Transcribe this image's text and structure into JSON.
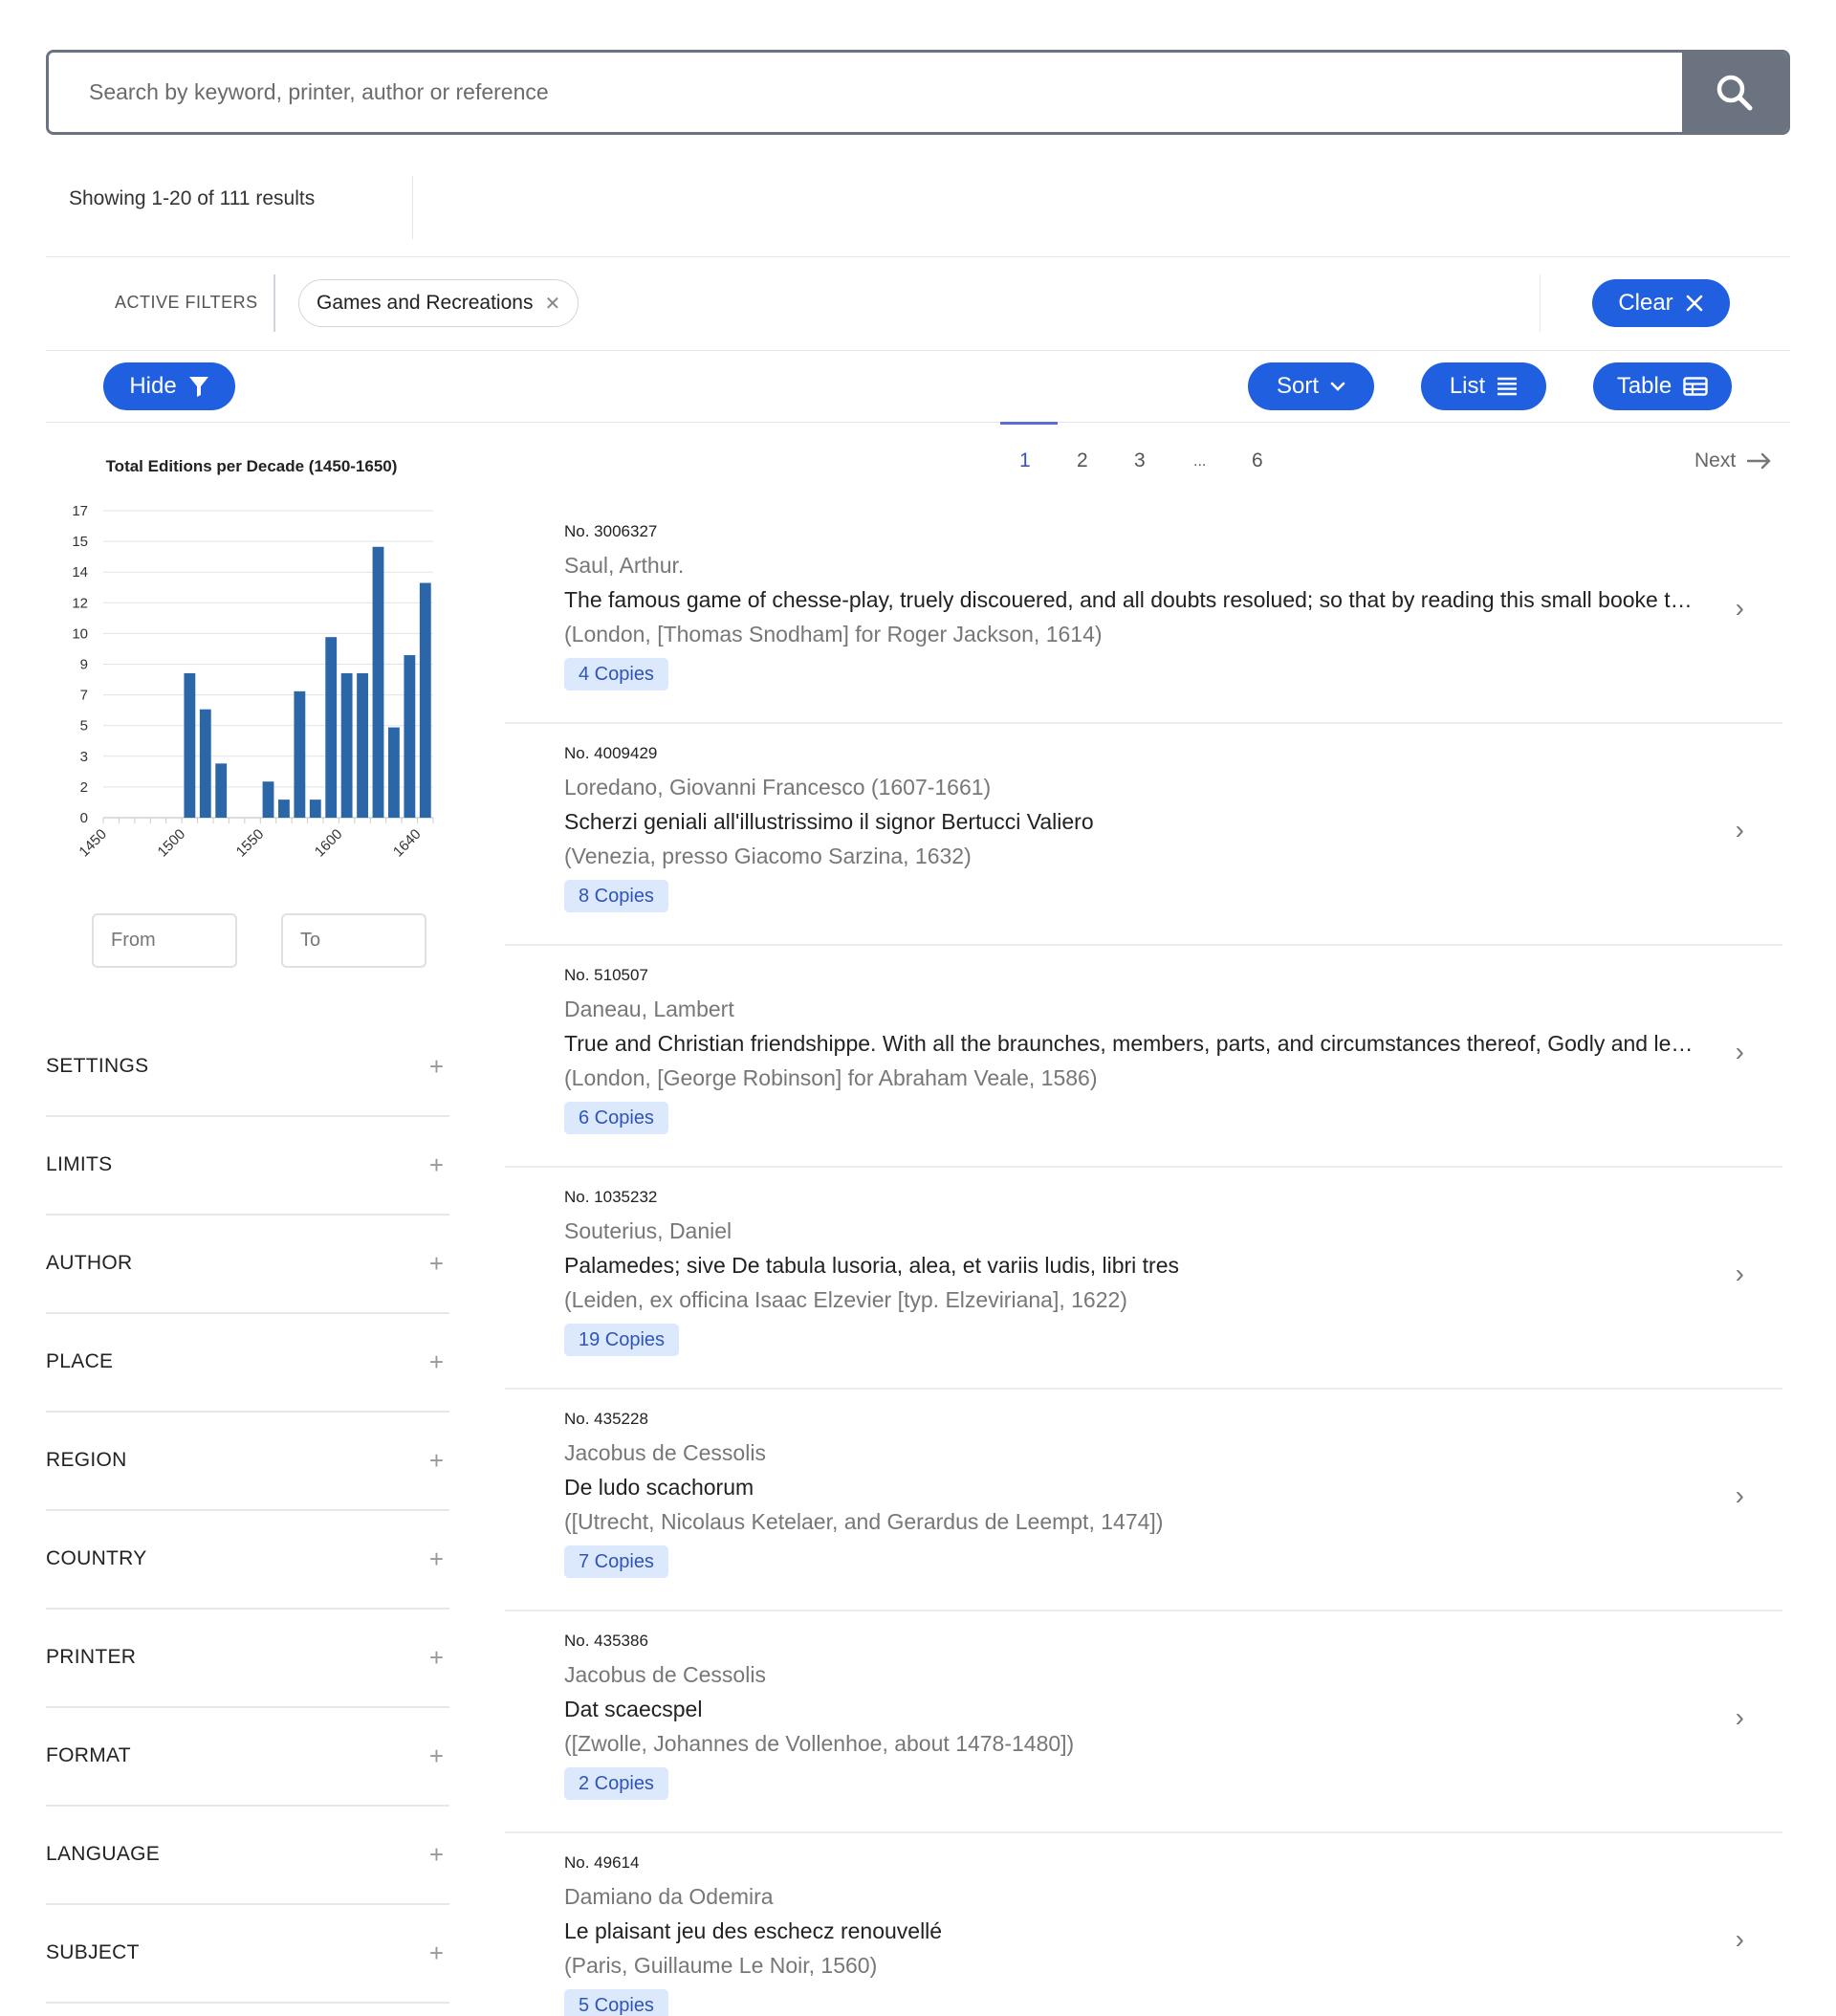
{
  "search": {
    "placeholder": "Search by keyword, printer, author or reference"
  },
  "results": {
    "summary": "Showing 1-20 of 111 results"
  },
  "filters": {
    "label": "ACTIVE FILTERS",
    "active": [
      "Games and Recreations"
    ],
    "clear_label": "Clear"
  },
  "toolbar": {
    "hide_label": "Hide",
    "sort_label": "Sort",
    "list_label": "List",
    "table_label": "Table"
  },
  "chart_data": {
    "type": "bar",
    "title": "Total Editions per Decade (1450-1650)",
    "xlabel": "",
    "ylabel": "",
    "x": [
      1450,
      1460,
      1470,
      1480,
      1490,
      1500,
      1510,
      1520,
      1530,
      1540,
      1550,
      1560,
      1570,
      1580,
      1590,
      1600,
      1610,
      1620,
      1630,
      1640
    ],
    "values": [
      0,
      0,
      0,
      0,
      0,
      8,
      6,
      3,
      0,
      0,
      2,
      1,
      7,
      1,
      10,
      8,
      8,
      15,
      5,
      9,
      13
    ],
    "x_ticks": [
      "1450",
      "1500",
      "1550",
      "1600",
      "1640"
    ],
    "y_ticks": [
      "17",
      "15",
      "14",
      "12",
      "10",
      "9",
      "7",
      "5",
      "3",
      "2",
      "0"
    ],
    "ylim": [
      0,
      17
    ],
    "grid": true
  },
  "range": {
    "from_placeholder": "From",
    "to_placeholder": "To"
  },
  "facets": [
    "SETTINGS",
    "LIMITS",
    "AUTHOR",
    "PLACE",
    "REGION",
    "COUNTRY",
    "PRINTER",
    "FORMAT",
    "LANGUAGE",
    "SUBJECT"
  ],
  "pagination": {
    "pages": [
      "1",
      "2",
      "3",
      "...",
      "6"
    ],
    "current": "1",
    "next_label": "Next"
  },
  "records": [
    {
      "no": "No. 3006327",
      "author": "Saul, Arthur.",
      "title": "The famous game of chesse-play, truely discouered, and all doubts resolued; so that by reading this small booke thou shalt profit",
      "imprint": "(London, [Thomas Snodham] for Roger Jackson, 1614)",
      "copies": "4 Copies"
    },
    {
      "no": "No. 4009429",
      "author": "Loredano, Giovanni Francesco (1607-1661)",
      "title": "Scherzi geniali all'illustrissimo il signor Bertucci Valiero",
      "imprint": "(Venezia, presso Giacomo Sarzina, 1632)",
      "copies": "8 Copies"
    },
    {
      "no": "No. 510507",
      "author": "Daneau, Lambert",
      "title": "True and Christian friendshippe. With all the braunches, members, parts, and circumstances thereof, Godly and learnedly declared",
      "imprint": "(London, [George Robinson] for Abraham Veale, 1586)",
      "copies": "6 Copies"
    },
    {
      "no": "No. 1035232",
      "author": "Souterius, Daniel",
      "title": "Palamedes; sive De tabula lusoria, alea, et variis ludis, libri tres",
      "imprint": "(Leiden, ex officina Isaac Elzevier [typ. Elzeviriana], 1622)",
      "copies": "19 Copies"
    },
    {
      "no": "No. 435228",
      "author": "Jacobus de Cessolis",
      "title": "De ludo scachorum",
      "imprint": "([Utrecht, Nicolaus Ketelaer, and Gerardus de Leempt, 1474])",
      "copies": "7 Copies"
    },
    {
      "no": "No. 435386",
      "author": "Jacobus de Cessolis",
      "title": "Dat scaecspel",
      "imprint": "([Zwolle, Johannes de Vollenhoe, about 1478-1480])",
      "copies": "2 Copies"
    },
    {
      "no": "No. 49614",
      "author": "Damiano da Odemira",
      "title": "Le plaisant jeu des eschecz renouvellé",
      "imprint": "(Paris, Guillaume Le Noir, 1560)",
      "copies": "5 Copies"
    }
  ],
  "colors": {
    "accent": "#1f5fe0",
    "bar": "#2b66a8",
    "search_button": "#6b7280",
    "copies_bg": "#dce8fb"
  }
}
